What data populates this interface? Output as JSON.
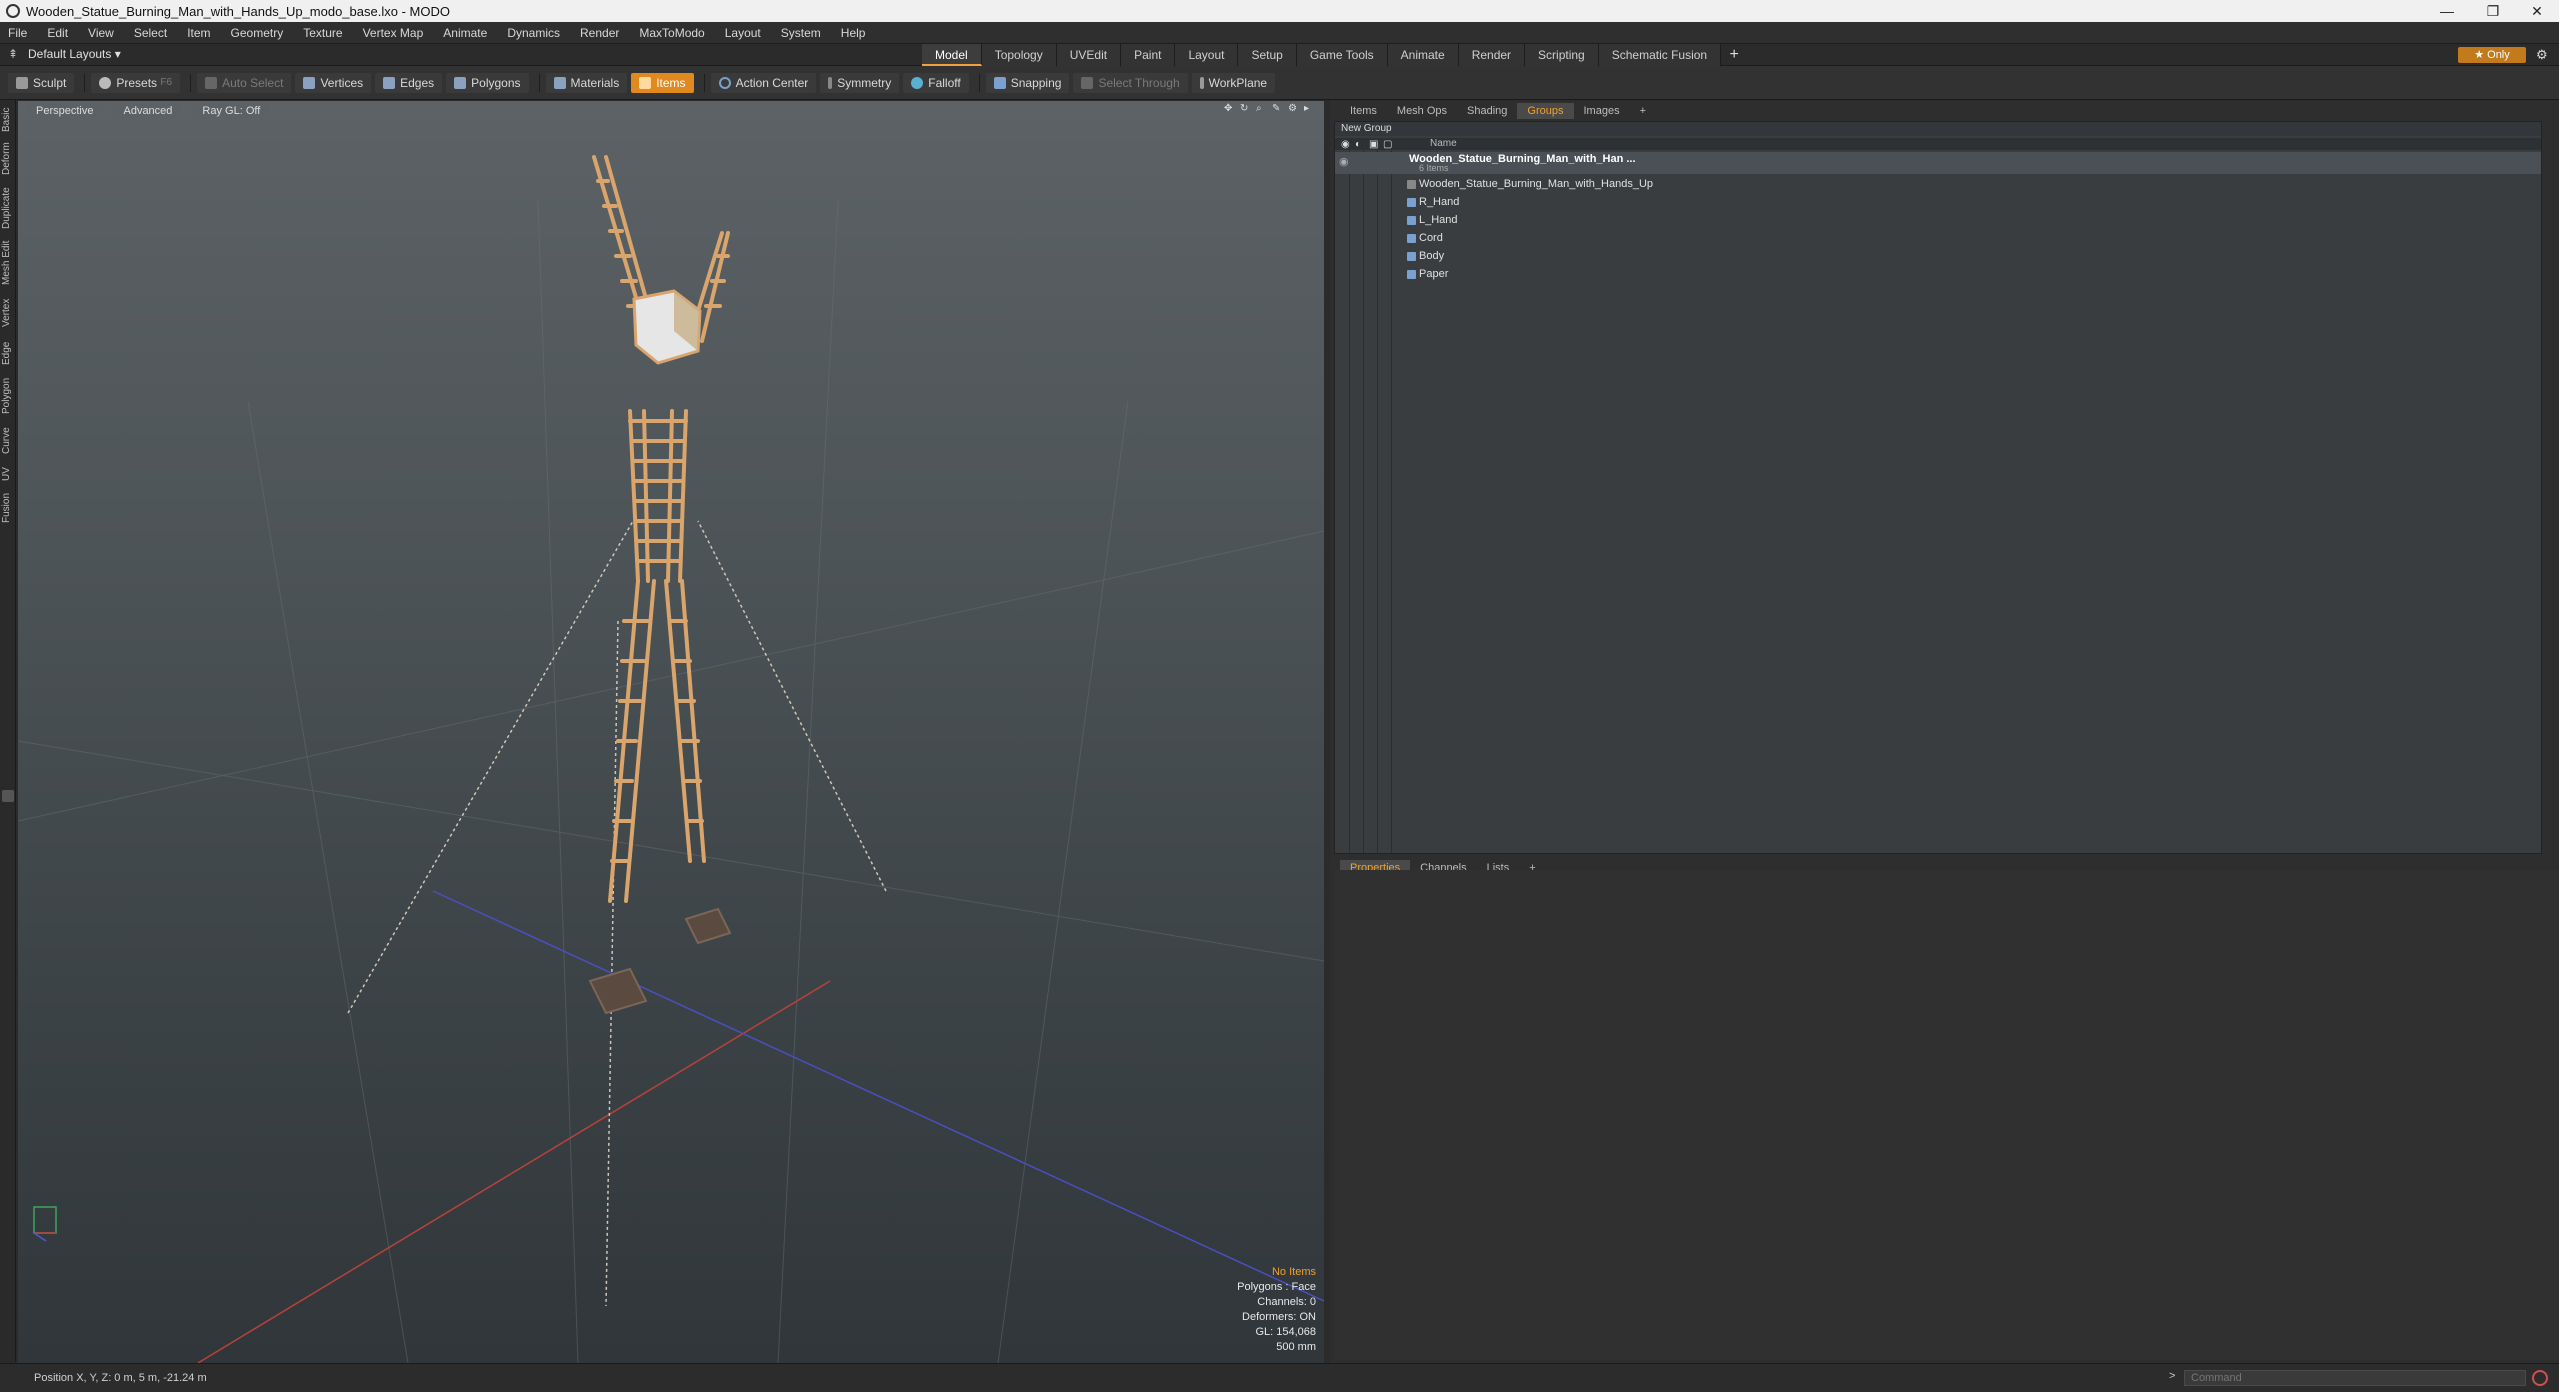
{
  "window": {
    "title": "Wooden_Statue_Burning_Man_with_Hands_Up_modo_base.lxo - MODO",
    "controls": [
      "—",
      "❐",
      "✕"
    ]
  },
  "menu": [
    "File",
    "Edit",
    "View",
    "Select",
    "Item",
    "Geometry",
    "Texture",
    "Vertex Map",
    "Animate",
    "Dynamics",
    "Render",
    "MaxToModo",
    "Layout",
    "System",
    "Help"
  ],
  "layout": {
    "selector": "Default Layouts ▾",
    "tabs": [
      "Model",
      "Topology",
      "UVEdit",
      "Paint",
      "Layout",
      "Setup",
      "Game Tools",
      "Animate",
      "Render",
      "Scripting",
      "Schematic Fusion"
    ],
    "active_tab": "Model",
    "add": "+",
    "only_button": "★ Only"
  },
  "toolbar": {
    "sculpt": "Sculpt",
    "presets": "Presets",
    "presets_key": "F6",
    "auto_select": "Auto Select",
    "vertices": "Vertices",
    "edges": "Edges",
    "polygons": "Polygons",
    "materials": "Materials",
    "items": "Items",
    "action_center": "Action Center",
    "symmetry": "Symmetry",
    "falloff": "Falloff",
    "snapping": "Snapping",
    "select_through": "Select Through",
    "workplane": "WorkPlane"
  },
  "left_tabs": [
    "Basic",
    "Deform",
    "Duplicate",
    "Mesh Edit",
    "Vertex",
    "Edge",
    "Polygon",
    "Curve",
    "UV",
    "Fusion"
  ],
  "viewport": {
    "view": "Perspective",
    "mode": "Advanced",
    "raygl": "Ray GL: Off",
    "info": {
      "no_items": "No Items",
      "polygons": "Polygons : Face",
      "channels": "Channels: 0",
      "deformers": "Deformers: ON",
      "gl": "GL: 154,068",
      "scale": "500 mm"
    },
    "colors": {
      "x_axis": "#b9423a",
      "z_axis": "#4a4fc0",
      "wood": "#d9a56c"
    }
  },
  "status": {
    "position": "Position X, Y, Z:  0 m, 5 m, -21.24 m",
    "command_prompt": ">",
    "command_placeholder": "Command"
  },
  "right_panel": {
    "tabs": [
      "Items",
      "Mesh Ops",
      "Shading",
      "Groups",
      "Images",
      "+"
    ],
    "active_tab": "Groups",
    "new_group": "New Group",
    "name_header": "Name",
    "group_name": "Wooden_Statue_Burning_Man_with_Han ...",
    "group_count": "6 Items",
    "items": [
      "Wooden_Statue_Burning_Man_with_Hands_Up",
      "R_Hand",
      "L_Hand",
      "Cord",
      "Body",
      "Paper"
    ],
    "props_tabs": [
      "Properties",
      "Channels",
      "Lists",
      "+"
    ],
    "props_active": "Properties"
  }
}
